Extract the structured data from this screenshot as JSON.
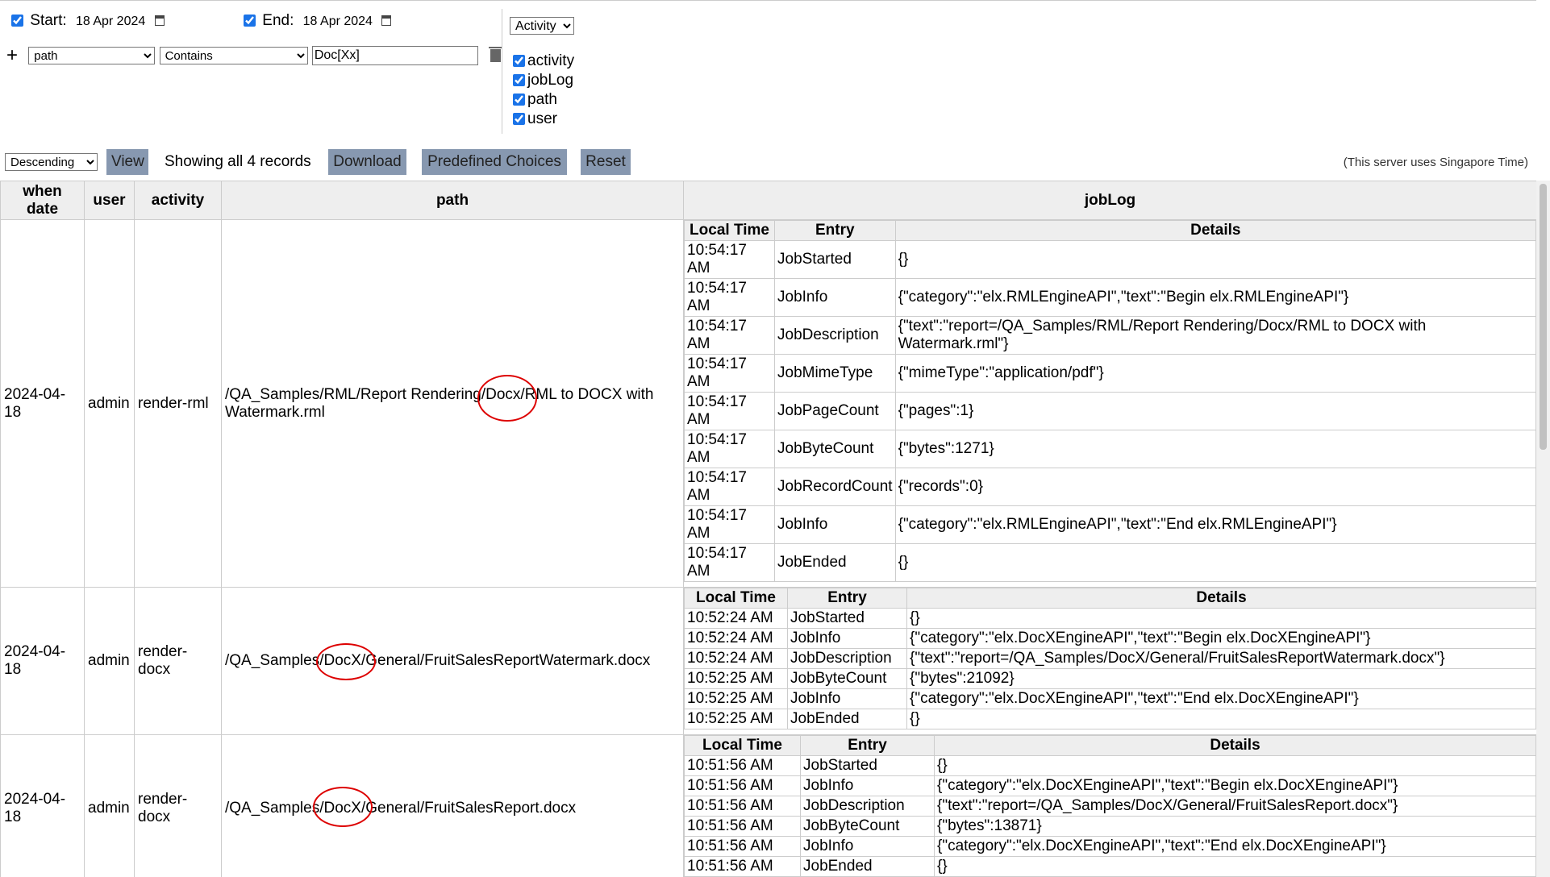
{
  "filters": {
    "start_label": "Start:",
    "start_date": "18 Apr 2024",
    "end_label": "End:",
    "end_date": "18 Apr 2024",
    "add_symbol": "+",
    "field_value": "path",
    "operator_value": "Contains",
    "text_value": "Doc[Xx]"
  },
  "columns_panel": {
    "selector_value": "Activity",
    "columns": [
      "activity",
      "jobLog",
      "path",
      "user"
    ]
  },
  "toolbar": {
    "sort_value": "Descending",
    "view_label": "View",
    "records_text": "Showing all 4 records",
    "download_label": "Download",
    "predefined_label": "Predefined Choices",
    "reset_label": "Reset",
    "timezone_note": "(This server uses Singapore Time)"
  },
  "table": {
    "headers": {
      "when_line1": "when",
      "when_line2": "date",
      "user": "user",
      "activity": "activity",
      "path": "path",
      "joblog": "jobLog"
    },
    "joblog_headers": {
      "time": "Local Time",
      "entry": "Entry",
      "details": "Details"
    },
    "rows": [
      {
        "date": "2024-04-18",
        "user": "admin",
        "activity": "render-rml",
        "path": "/QA_Samples/RML/Report Rendering/Docx/RML to DOCX with Watermark.rml",
        "log": [
          {
            "time": "10:54:17 AM",
            "entry": "JobStarted",
            "details": "{}"
          },
          {
            "time": "10:54:17 AM",
            "entry": "JobInfo",
            "details": "{\"category\":\"elx.RMLEngineAPI\",\"text\":\"Begin elx.RMLEngineAPI\"}"
          },
          {
            "time": "10:54:17 AM",
            "entry": "JobDescription",
            "details": "{\"text\":\"report=/QA_Samples/RML/Report Rendering/Docx/RML to DOCX with Watermark.rml\"}"
          },
          {
            "time": "10:54:17 AM",
            "entry": "JobMimeType",
            "details": "{\"mimeType\":\"application/pdf\"}"
          },
          {
            "time": "10:54:17 AM",
            "entry": "JobPageCount",
            "details": "{\"pages\":1}"
          },
          {
            "time": "10:54:17 AM",
            "entry": "JobByteCount",
            "details": "{\"bytes\":1271}"
          },
          {
            "time": "10:54:17 AM",
            "entry": "JobRecordCount",
            "details": "{\"records\":0}"
          },
          {
            "time": "10:54:17 AM",
            "entry": "JobInfo",
            "details": "{\"category\":\"elx.RMLEngineAPI\",\"text\":\"End elx.RMLEngineAPI\"}"
          },
          {
            "time": "10:54:17 AM",
            "entry": "JobEnded",
            "details": "{}"
          }
        ]
      },
      {
        "date": "2024-04-18",
        "user": "admin",
        "activity": "render-docx",
        "path": "/QA_Samples/DocX/General/FruitSalesReportWatermark.docx",
        "log": [
          {
            "time": "10:52:24 AM",
            "entry": "JobStarted",
            "details": "{}"
          },
          {
            "time": "10:52:24 AM",
            "entry": "JobInfo",
            "details": "{\"category\":\"elx.DocXEngineAPI\",\"text\":\"Begin elx.DocXEngineAPI\"}"
          },
          {
            "time": "10:52:24 AM",
            "entry": "JobDescription",
            "details": "{\"text\":\"report=/QA_Samples/DocX/General/FruitSalesReportWatermark.docx\"}"
          },
          {
            "time": "10:52:25 AM",
            "entry": "JobByteCount",
            "details": "{\"bytes\":21092}"
          },
          {
            "time": "10:52:25 AM",
            "entry": "JobInfo",
            "details": "{\"category\":\"elx.DocXEngineAPI\",\"text\":\"End elx.DocXEngineAPI\"}"
          },
          {
            "time": "10:52:25 AM",
            "entry": "JobEnded",
            "details": "{}"
          }
        ]
      },
      {
        "date": "2024-04-18",
        "user": "admin",
        "activity": "render-docx",
        "path": "/QA_Samples/DocX/General/FruitSalesReport.docx",
        "log": [
          {
            "time": "10:51:56 AM",
            "entry": "JobStarted",
            "details": "{}"
          },
          {
            "time": "10:51:56 AM",
            "entry": "JobInfo",
            "details": "{\"category\":\"elx.DocXEngineAPI\",\"text\":\"Begin elx.DocXEngineAPI\"}"
          },
          {
            "time": "10:51:56 AM",
            "entry": "JobDescription",
            "details": "{\"text\":\"report=/QA_Samples/DocX/General/FruitSalesReport.docx\"}"
          },
          {
            "time": "10:51:56 AM",
            "entry": "JobByteCount",
            "details": "{\"bytes\":13871}"
          },
          {
            "time": "10:51:56 AM",
            "entry": "JobInfo",
            "details": "{\"category\":\"elx.DocXEngineAPI\",\"text\":\"End elx.DocXEngineAPI\"}"
          },
          {
            "time": "10:51:56 AM",
            "entry": "JobEnded",
            "details": "{}"
          }
        ]
      }
    ]
  },
  "colors": {
    "button_bg": "#8798b0",
    "header_bg": "#eeeeee",
    "annotation": "#dd0000",
    "checkbox": "#1a73e8"
  }
}
